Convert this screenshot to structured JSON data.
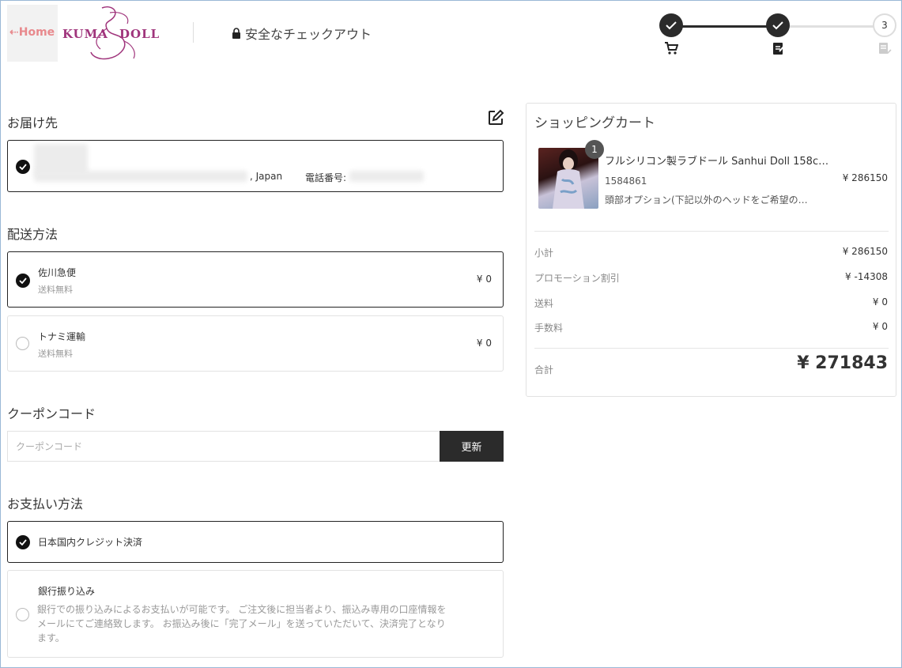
{
  "header": {
    "home_label": "⇠Home",
    "logo_left": "KUMA",
    "logo_right": "DOLL",
    "secure_checkout": "安全なチェックアウト",
    "steps": [
      {
        "state": "done",
        "icon": "cart-icon"
      },
      {
        "state": "done",
        "icon": "form-icon"
      },
      {
        "state": "current",
        "number": "3",
        "icon": "receipt-icon"
      }
    ]
  },
  "address": {
    "title": "お届け先",
    "country": ", Japan",
    "phone_label": "電話番号:"
  },
  "shipping": {
    "title": "配送方法",
    "options": [
      {
        "name": "佐川急便",
        "note": "送料無料",
        "price": "¥ 0",
        "selected": true
      },
      {
        "name": "トナミ運輸",
        "note": "送料無料",
        "price": "¥ 0",
        "selected": false
      }
    ]
  },
  "coupon": {
    "title": "クーポンコード",
    "placeholder": "クーポンコード",
    "button": "更新"
  },
  "payment": {
    "title": "お支払い方法",
    "options": [
      {
        "name": "日本国内クレジット決済",
        "selected": true
      },
      {
        "name": "銀行振り込み",
        "selected": false,
        "description": "銀行での振り込みによるお支払いが可能です。 ご注文後に担当者より、振込み専用の口座情報をメールにてご連絡致します。 お振込み後に「完了メール」を送っていただいて、決済完了となります。"
      }
    ]
  },
  "cart": {
    "title": "ショッピングカート",
    "item": {
      "qty": "1",
      "name": "フルシリコン製ラブドール Sanhui Doll 158c…",
      "sku": "1584861",
      "price": "¥ 286150",
      "option": "頭部オプション(下記以外のヘッドをご希望の…"
    },
    "summary": [
      {
        "label": "小計",
        "value": "¥ 286150"
      },
      {
        "label": "プロモーション割引",
        "value": "¥ -14308"
      },
      {
        "label": "送料",
        "value": "¥ 0"
      },
      {
        "label": "手数料",
        "value": "¥ 0"
      }
    ],
    "total_label": "合計",
    "total_value": "¥ 271843"
  }
}
